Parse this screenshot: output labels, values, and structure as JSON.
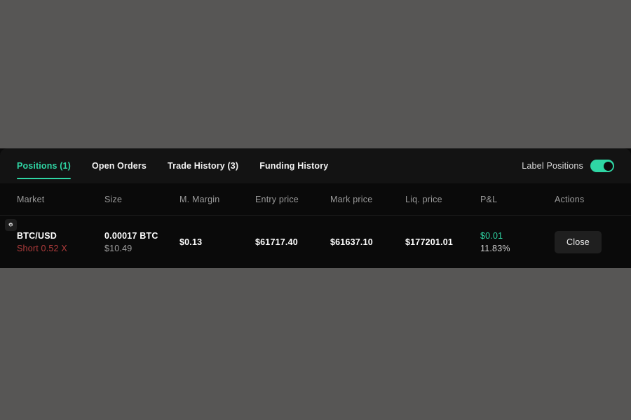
{
  "panel": {
    "tabs": [
      {
        "label": "Positions (1)",
        "active": true
      },
      {
        "label": "Open Orders",
        "active": false
      },
      {
        "label": "Trade History (3)",
        "active": false
      },
      {
        "label": "Funding History",
        "active": false
      }
    ],
    "toggle": {
      "label": "Label Positions",
      "state": "on"
    },
    "columns": [
      "Market",
      "Size",
      "M. Margin",
      "Entry price",
      "Mark price",
      "Liq. price",
      "P&L",
      "Actions"
    ],
    "rows": [
      {
        "settings_icon": "gear-icon",
        "market": "BTC/USD",
        "side": "Short 0.52 X",
        "size": "0.00017 BTC",
        "size_usd": "$10.49",
        "maintenance_margin": "$0.13",
        "entry_price": "$61717.40",
        "mark_price": "$61637.10",
        "liq_price": "$177201.01",
        "pnl": "$0.01",
        "pnl_pct": "11.83%",
        "action_label": "Close"
      }
    ]
  },
  "colors": {
    "accent": "#2fd6a4",
    "short": "#b03c3c",
    "panel_bg": "#0a0a0a",
    "tabbar_bg": "#131313",
    "page_bg": "#575655"
  }
}
